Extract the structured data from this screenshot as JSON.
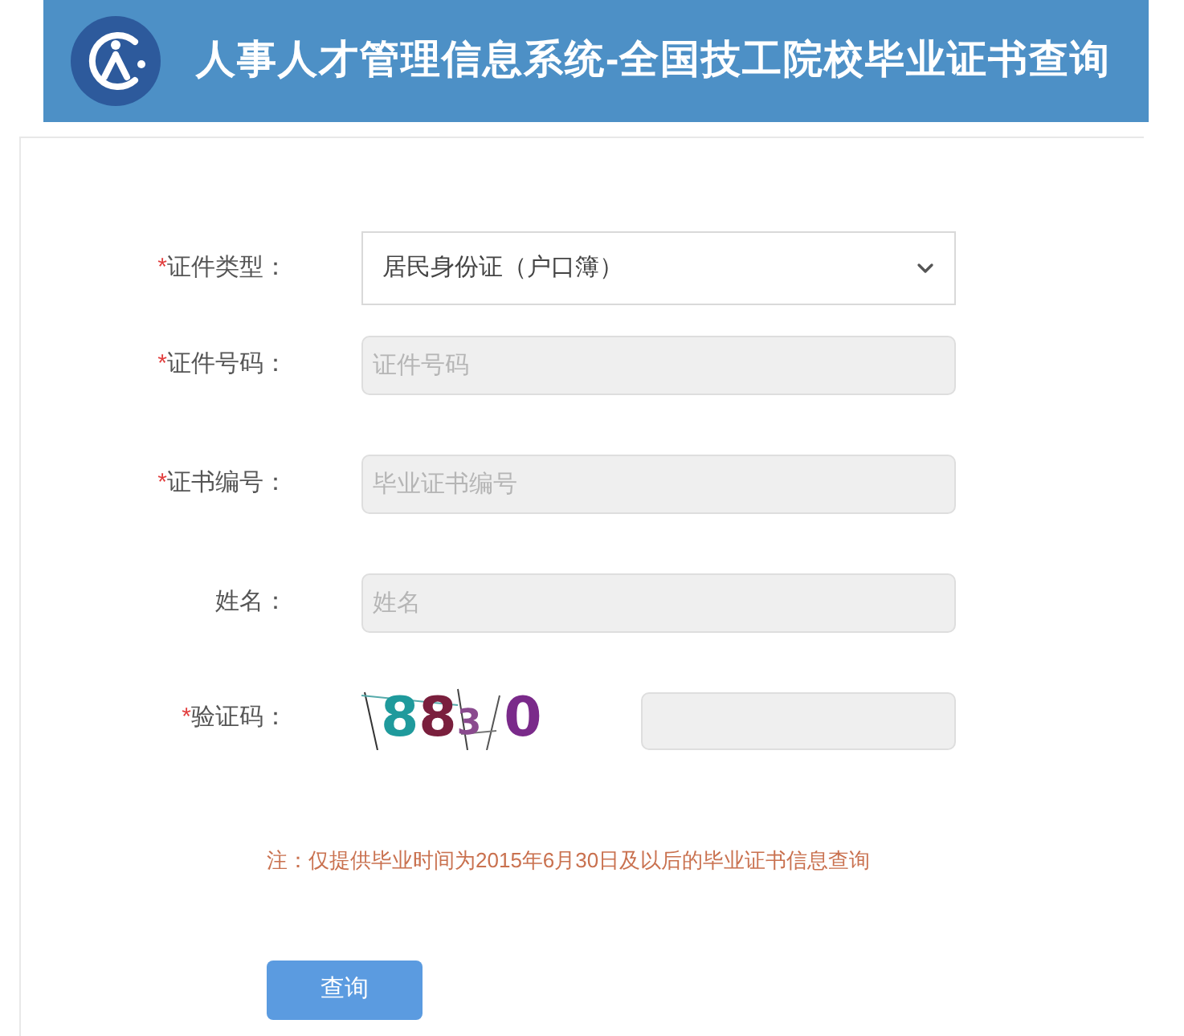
{
  "header": {
    "title": "人事人才管理信息系统-全国技工院校毕业证书查询"
  },
  "form": {
    "fields": [
      {
        "kind": "select",
        "required_mark": "*",
        "label": "证件类型：",
        "value": "居民身份证（户口簿）"
      },
      {
        "kind": "text",
        "required_mark": "*",
        "label": "证件号码：",
        "placeholder": "证件号码"
      },
      {
        "kind": "text",
        "required_mark": "*",
        "label": "证书编号：",
        "placeholder": "毕业证书编号"
      },
      {
        "kind": "text",
        "label": "姓名：",
        "placeholder": "姓名"
      },
      {
        "kind": "captcha",
        "required_mark": "*",
        "label": "验证码：",
        "captcha": [
          {
            "char": "8",
            "color": "#1f9a9c"
          },
          {
            "char": "8",
            "color": "#7a1f3d"
          },
          {
            "char": "3",
            "color": "#8a4a8e"
          },
          {
            "char": "0",
            "color": "#7a2a8a"
          }
        ]
      }
    ],
    "note": "注：仅提供毕业时间为2015年6月30日及以后的毕业证书信息查询",
    "submit": "查询"
  }
}
